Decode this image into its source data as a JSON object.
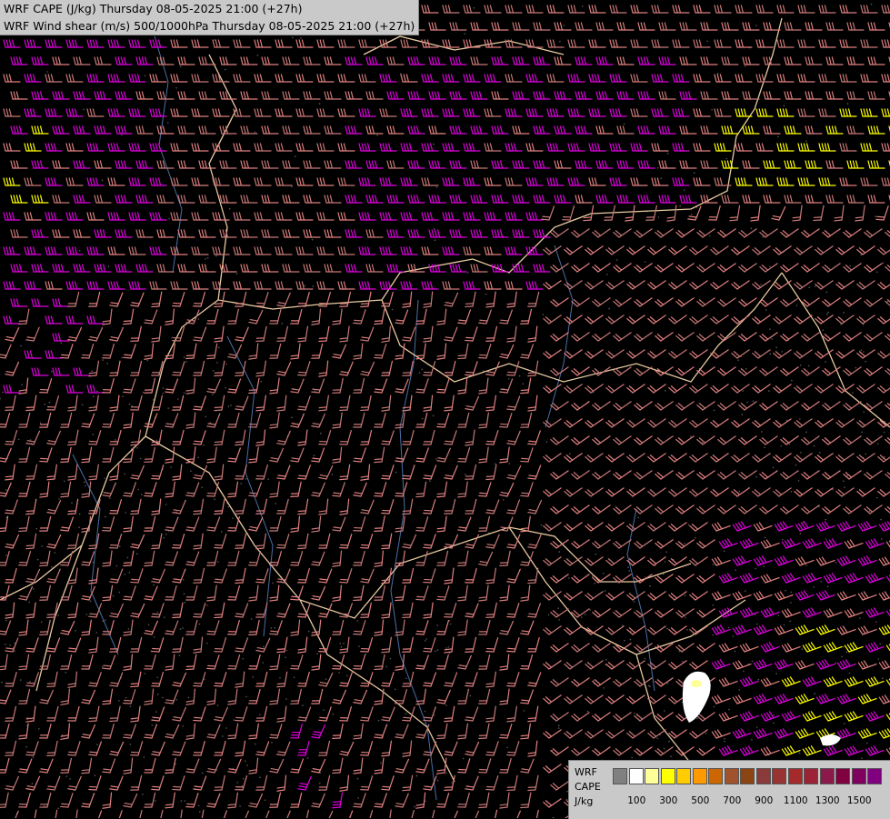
{
  "header": {
    "line1": "WRF CAPE (J/kg) Thursday 08-05-2025 21:00 (+27h)",
    "line2": "WRF Wind shear (m/s) 500/1000hPa Thursday 08-05-2025 21:00 (+27h)"
  },
  "legend": {
    "label_model": "WRF",
    "label_field": "CAPE",
    "label_unit": "J/kg",
    "swatch_colors": [
      "#808080",
      "#ffffff",
      "#ffff99",
      "#ffff00",
      "#ffcc00",
      "#ff9900",
      "#cc6600",
      "#a0522d",
      "#8b4513",
      "#8b3a3a",
      "#993333",
      "#a52a2a",
      "#9b2335",
      "#8b1a4a",
      "#800040",
      "#800060",
      "#800080"
    ],
    "ticks": [
      "100",
      "300",
      "500",
      "700",
      "900",
      "1100",
      "1300",
      "1500"
    ]
  },
  "colors": {
    "background": "#000000",
    "border": "#e8c9a0",
    "river": "#4a6fa5",
    "barb_weak": "#c87878",
    "barb_medium": "#e08080",
    "barb_strong": "#e000e0",
    "barb_extreme": "#ffff00",
    "cape_high": "#ffffff"
  }
}
